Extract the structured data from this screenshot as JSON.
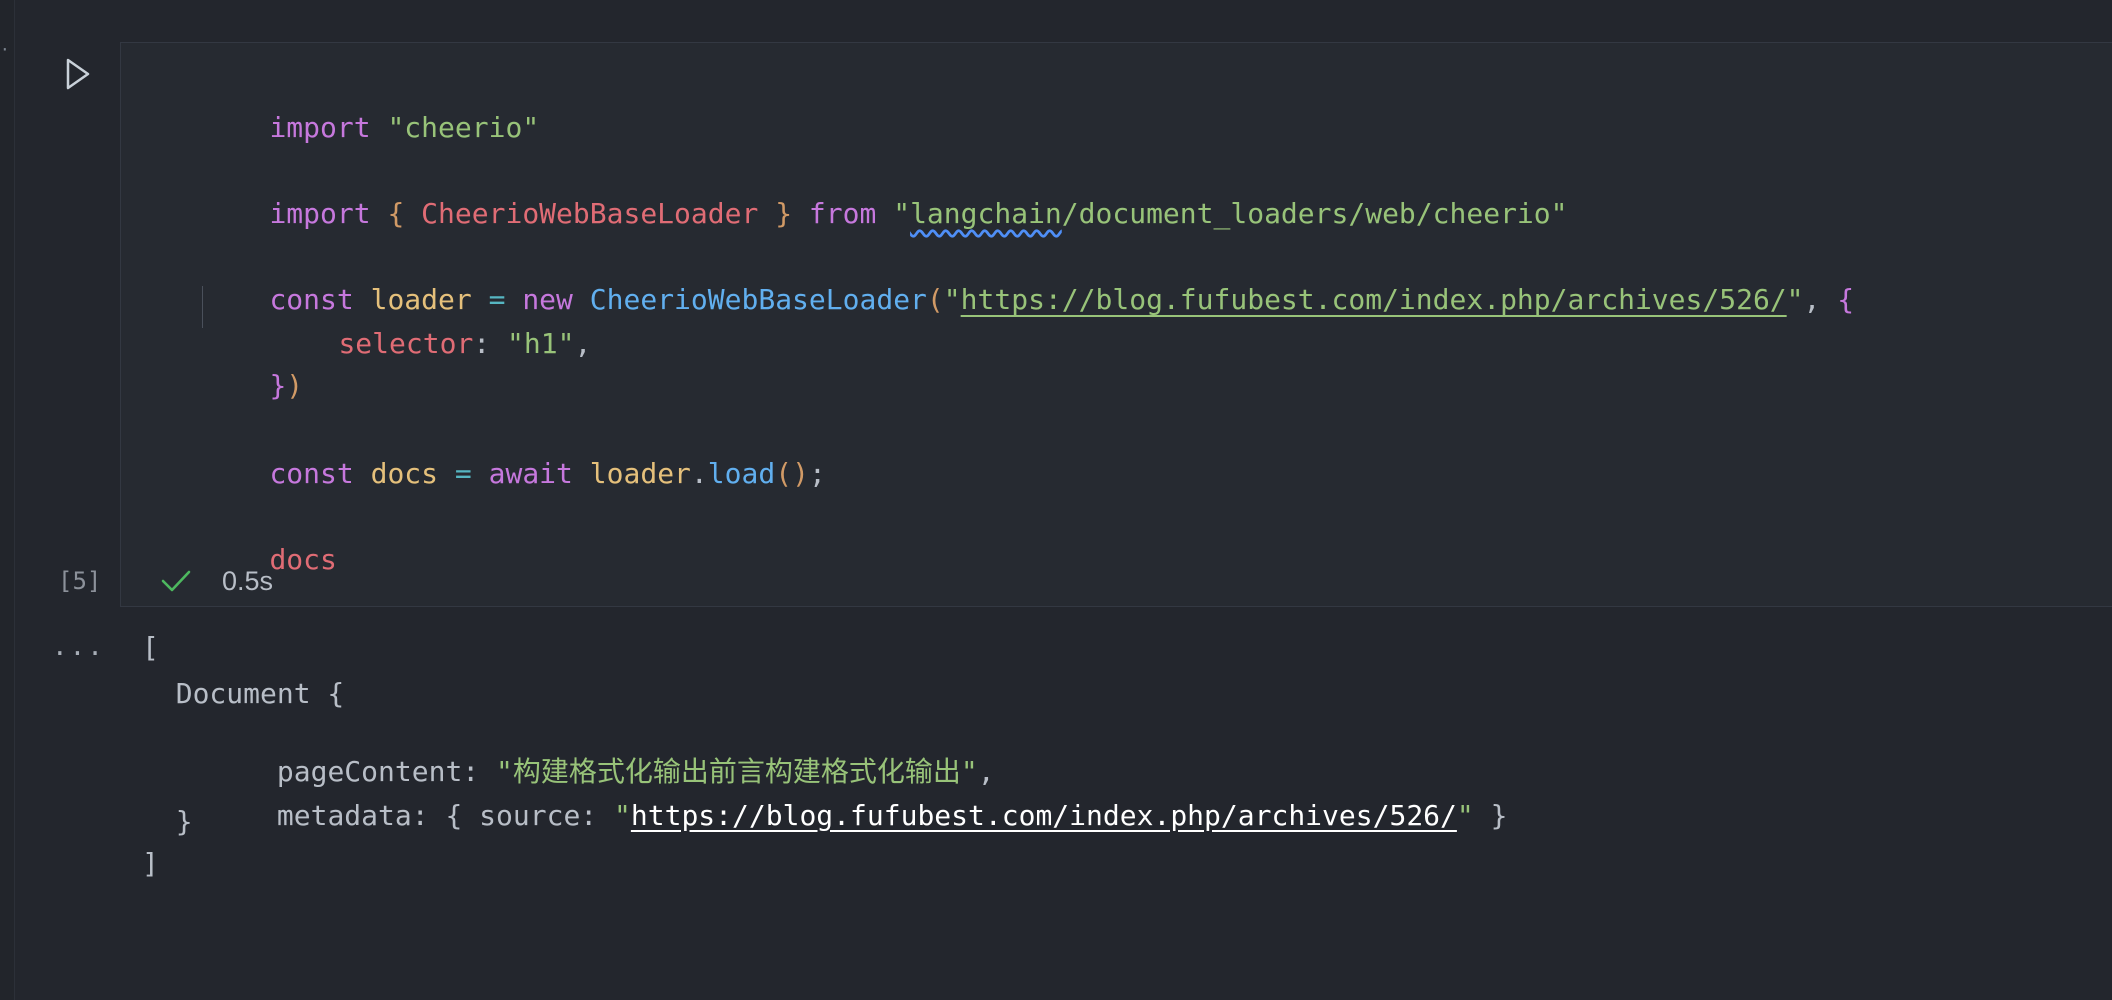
{
  "cell": {
    "run_label": "Run cell",
    "execution_count": "[5]",
    "status_time": "0.5s",
    "code": {
      "l1_import": "import",
      "l1_module": "\"cheerio\"",
      "l2_import": "import",
      "l2_brace_open": "{",
      "l2_class": "CheerioWebBaseLoader",
      "l2_brace_close": "}",
      "l2_from": "from",
      "l2_quote_open": "\"",
      "l2_path_wavy": "langchain",
      "l2_path_rest": "/document_loaders/web/cheerio\"",
      "l3_const": "const",
      "l3_var": "loader",
      "l3_eq": "=",
      "l3_new": "new",
      "l3_class": "CheerioWebBaseLoader",
      "l3_paren": "(",
      "l3_quote_open": "\"",
      "l3_url": "https://blog.fufubest.com/index.php/archives/526/",
      "l3_quote_close": "\"",
      "l3_comma": ", ",
      "l3_brace": "{",
      "l4_prop": "selector",
      "l4_colon": ": ",
      "l4_value": "\"h1\"",
      "l4_comma": ",",
      "l5_brace": "}",
      "l5_paren": ")",
      "l6_const": "const",
      "l6_var": "docs",
      "l6_eq": "=",
      "l6_await": "await",
      "l6_obj": "loader",
      "l6_dot": ".",
      "l6_fn": "load",
      "l6_call": "()",
      "l6_semi": ";",
      "l7_docs": "docs"
    }
  },
  "output": {
    "more_label": "...",
    "line1": "[",
    "line2": "  Document {",
    "line3_key": "    pageContent: ",
    "line3_value": "\"构建格式化输出前言构建格式化输出\"",
    "line3_comma": ",",
    "line4_key": "    metadata: { source: ",
    "line4_quote_open": "\"",
    "line4_url": "https://blog.fufubest.com/index.php/archives/526/",
    "line4_quote_close": "\"",
    "line4_tail": " }",
    "line5": "  }",
    "line6": "]"
  }
}
